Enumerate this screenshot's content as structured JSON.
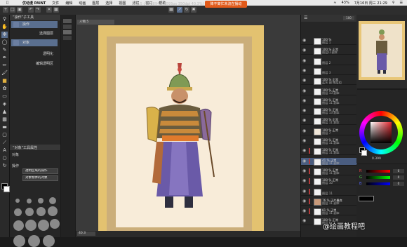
{
  "menubar": {
    "app": "优动漫 PAINT",
    "items": [
      "文件",
      "编辑",
      "动画",
      "图层",
      "选择",
      "视图",
      "滤镜",
      "窗口",
      "帮助"
    ],
    "battery": "43%",
    "datetime": "7月16日 周三 21:29"
  },
  "toolbar": {
    "doc_info": "人物.5 (A4 2894 x 4093px 350dpi 40.3%) - 优动漫 PAINT 个人版",
    "recording": "降不离忙未流在播动"
  },
  "subtool": {
    "title": "“操作”子工具",
    "items": [
      "操作",
      "选择图层",
      "对象",
      "透明化",
      "编辑透明区"
    ],
    "property_title": "“对象”工具属性",
    "object_label": "对象",
    "operation_label": "操作",
    "select1": "透明区域的操作",
    "select2": "对象物体的对象"
  },
  "canvas": {
    "tab_label": "人物.5",
    "zoom": "40.3"
  },
  "layers": {
    "rows": [
      {
        "a": "100 %",
        "b": "图层 1"
      },
      {
        "a": "100 % 正常",
        "b": "图层11副本"
      },
      {
        "a": "",
        "b": "图层 2"
      },
      {
        "a": "",
        "b": "图层 3"
      },
      {
        "a": "100 % 正常",
        "b": "盐灰 副 图层组"
      },
      {
        "a": "100 % 正常",
        "b": "图层 13 副本"
      },
      {
        "a": "100 % 正常",
        "b": "图层 11 副本"
      },
      {
        "a": "100 % 正常",
        "b": "图层 13 副本"
      },
      {
        "a": "100 % 正常",
        "b": "图层 11 副本"
      },
      {
        "a": "100 % 正常",
        "b": "图层 7"
      },
      {
        "a": "100 % 正常",
        "b": "图层 11 副本"
      },
      {
        "a": "100 % 正常",
        "b": "图层 11 副本"
      },
      {
        "a": "41 % 正常",
        "b": "图层 11 副本"
      },
      {
        "a": "100 % 正常",
        "b": "图层 11 副本"
      },
      {
        "a": "100 % 正常",
        "b": "图层 10"
      },
      {
        "a": "",
        "b": "图层 11"
      },
      {
        "a": "76 % 正片叠底",
        "b": "图层 11 副本"
      },
      {
        "a": "81 % 正常",
        "b": "图层 11 副本"
      },
      {
        "a": "100 % 正常",
        "b": "图层 6"
      }
    ]
  },
  "color": {
    "values": [
      "0",
      "0",
      "0"
    ],
    "brush_size": "0.399"
  },
  "watermark": "@绘画教程吧",
  "colors": {
    "accent": "#5a6f8f",
    "recording": "#e15a1a",
    "frame": "#e3c270",
    "paper": "#f8ecd9"
  }
}
